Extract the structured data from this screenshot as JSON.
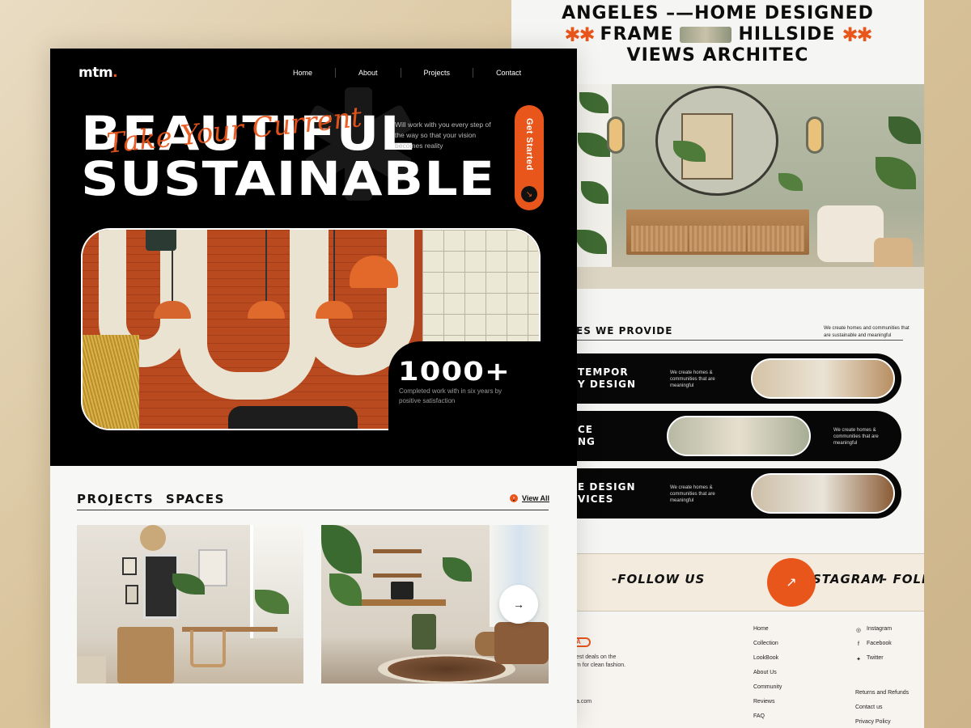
{
  "back_page": {
    "marquee": {
      "line1": "ANGELES –—HOME DESIGNED",
      "line2_left": "✱✱",
      "line2_a": "FRAME",
      "line2_b": "HILLSIDE",
      "line2_right": "✱✱",
      "line3": "VIEWS ARCHITEC"
    },
    "services": {
      "heading": "ES WE PROVIDE",
      "subtitle": "We create homes and communities that are sustainable and meaningful",
      "items": [
        {
          "title_l1": "TEMPOR",
          "title_l2": "Y DESIGN",
          "desc": "We create homes & communities that are meaningful"
        },
        {
          "title_l1": "CE",
          "title_l2": "NG",
          "desc": "We create homes & communities that are meaningful"
        },
        {
          "title_l1": "E DESIGN",
          "title_l2": "VICES",
          "desc": "We create homes & communities that are meaningful"
        }
      ]
    },
    "follow": {
      "text_main": "-FOLLOW US",
      "text_main_end": "STAGRAM",
      "text_repeat": "- FOLL",
      "button_icon": "arrow-up-right-icon"
    },
    "footer": {
      "logo_text": "A",
      "tagline_l1": "est deals on the",
      "tagline_l2": "m for clean fashion.",
      "email": "a.com",
      "links": [
        "Home",
        "Collection",
        "LookBook",
        "About Us",
        "Community",
        "Reviews",
        "FAQ"
      ],
      "social": [
        {
          "icon": "instagram-icon",
          "label": "Instagram"
        },
        {
          "icon": "facebook-icon",
          "label": "Facebook"
        },
        {
          "icon": "twitter-icon",
          "label": "Twitter"
        }
      ],
      "support": [
        "Returns and Refunds",
        "Contact us",
        "Privacy Policy"
      ]
    }
  },
  "front_page": {
    "logo": {
      "text": "mtm",
      "dot": "."
    },
    "nav": [
      "Home",
      "About",
      "Projects",
      "Contact"
    ],
    "hero": {
      "line1": "BEAUTIFUL",
      "line2": "SUSTAINABLE",
      "script": "Take Your Current",
      "description": "Will work with you every step of the way so that your vision becomes reality",
      "cta": "Get Started",
      "cta_icon": "arrow-down-right-icon"
    },
    "stat": {
      "number": "1000+",
      "description": "Completed work with in six years by positive satisfaction"
    },
    "projects": {
      "heading": "PROJECTS SPACES",
      "view_all": "View All",
      "next_icon": "arrow-right-icon"
    }
  },
  "colors": {
    "accent": "#e8561b",
    "hero_bg": "#000000",
    "page_bg": "#f7f7f5",
    "backdrop": "#d9c49c"
  }
}
